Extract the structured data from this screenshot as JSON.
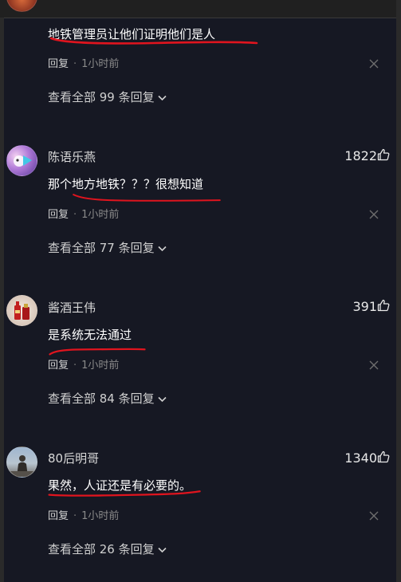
{
  "colors": {
    "background": "#161823",
    "text_primary": "#ffffff",
    "text_secondary": "#cfcfcf",
    "text_muted": "#8a8a8a",
    "annotation_red": "#e0141e"
  },
  "comments": [
    {
      "username": "",
      "content": "地铁管理员让他们证明他们是人",
      "likes": "",
      "reply_label": "回复",
      "separator": "·",
      "time": "1小时前",
      "view_replies": "查看全部 99 条回复",
      "avatar_icon": "avatar-partial-icon"
    },
    {
      "username": "陈语乐燕",
      "content": "那个地方地铁？？？很想知道",
      "likes": "1822",
      "reply_label": "回复",
      "separator": "·",
      "time": "1小时前",
      "view_replies": "查看全部 77 条回复",
      "avatar_icon": "cartoon-avatar-icon"
    },
    {
      "username": "酱酒王伟",
      "content": "是系统无法通过",
      "likes": "391",
      "reply_label": "回复",
      "separator": "·",
      "time": "1小时前",
      "view_replies": "查看全部 84 条回复",
      "avatar_icon": "liquor-bottle-avatar-icon"
    },
    {
      "username": "80后明哥",
      "content": "果然，人证还是有必要的。",
      "likes": "1340",
      "reply_label": "回复",
      "separator": "·",
      "time": "1小时前",
      "view_replies": "查看全部 26 条回复",
      "avatar_icon": "person-photo-avatar-icon"
    }
  ]
}
